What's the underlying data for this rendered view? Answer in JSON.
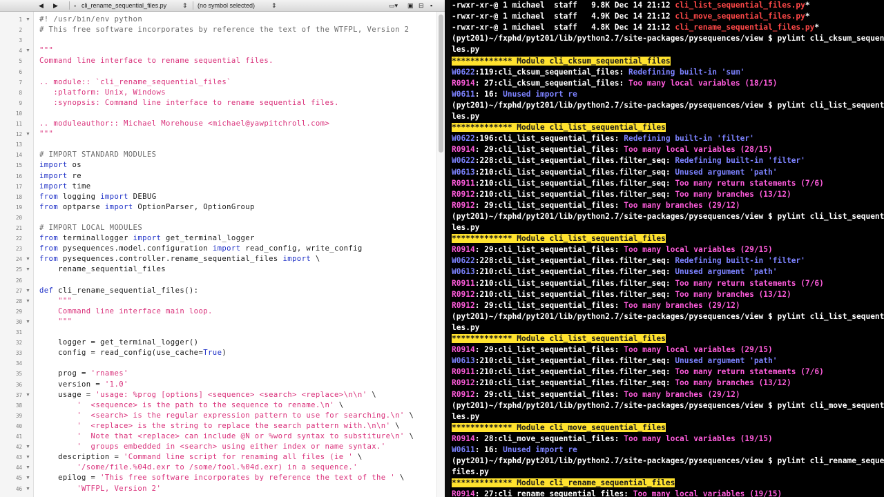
{
  "editor": {
    "toolbar": {
      "back_icon": "back-arrow-icon",
      "forward_icon": "forward-arrow-icon",
      "file_name": "cli_rename_sequential_files.py",
      "symbol": "(no symbol selected)"
    },
    "lines": [
      {
        "n": "1",
        "fold": true,
        "segs": [
          {
            "c": "com",
            "t": "#! /usr/bin/env python"
          }
        ]
      },
      {
        "n": "2",
        "segs": [
          {
            "c": "com",
            "t": "# This free software incorporates by reference the text of the WTFPL, Version 2"
          }
        ]
      },
      {
        "n": "3",
        "segs": []
      },
      {
        "n": "4",
        "fold": true,
        "segs": [
          {
            "c": "str",
            "t": "\"\"\""
          }
        ]
      },
      {
        "n": "5",
        "segs": [
          {
            "c": "str",
            "t": "Command line interface to rename sequential files."
          }
        ]
      },
      {
        "n": "6",
        "segs": []
      },
      {
        "n": "7",
        "segs": [
          {
            "c": "str",
            "t": ".. module:: `cli_rename_sequential_files`"
          }
        ]
      },
      {
        "n": "8",
        "segs": [
          {
            "c": "str",
            "t": "   :platform: Unix, Windows"
          }
        ]
      },
      {
        "n": "9",
        "segs": [
          {
            "c": "str",
            "t": "   :synopsis: Command line interface to rename sequential files."
          }
        ]
      },
      {
        "n": "10",
        "segs": []
      },
      {
        "n": "11",
        "segs": [
          {
            "c": "str",
            "t": ".. moduleauthor:: Michael Morehouse <michael@yawpitchroll.com>"
          }
        ]
      },
      {
        "n": "12",
        "fold": true,
        "segs": [
          {
            "c": "str",
            "t": "\"\"\""
          }
        ]
      },
      {
        "n": "13",
        "segs": []
      },
      {
        "n": "14",
        "segs": [
          {
            "c": "com",
            "t": "# IMPORT STANDARD MODULES"
          }
        ]
      },
      {
        "n": "15",
        "segs": [
          {
            "c": "kw",
            "t": "import"
          },
          {
            "c": "plain",
            "t": " os"
          }
        ]
      },
      {
        "n": "16",
        "segs": [
          {
            "c": "kw",
            "t": "import"
          },
          {
            "c": "plain",
            "t": " re"
          }
        ]
      },
      {
        "n": "17",
        "segs": [
          {
            "c": "kw",
            "t": "import"
          },
          {
            "c": "plain",
            "t": " time"
          }
        ]
      },
      {
        "n": "18",
        "segs": [
          {
            "c": "kw",
            "t": "from"
          },
          {
            "c": "plain",
            "t": " logging "
          },
          {
            "c": "kw",
            "t": "import"
          },
          {
            "c": "plain",
            "t": " DEBUG"
          }
        ]
      },
      {
        "n": "19",
        "segs": [
          {
            "c": "kw",
            "t": "from"
          },
          {
            "c": "plain",
            "t": " optparse "
          },
          {
            "c": "kw",
            "t": "import"
          },
          {
            "c": "plain",
            "t": " OptionParser, OptionGroup"
          }
        ]
      },
      {
        "n": "20",
        "segs": []
      },
      {
        "n": "21",
        "segs": [
          {
            "c": "com",
            "t": "# IMPORT LOCAL MODULES"
          }
        ]
      },
      {
        "n": "22",
        "segs": [
          {
            "c": "kw",
            "t": "from"
          },
          {
            "c": "plain",
            "t": " terminallogger "
          },
          {
            "c": "kw",
            "t": "import"
          },
          {
            "c": "plain",
            "t": " get_terminal_logger"
          }
        ]
      },
      {
        "n": "23",
        "segs": [
          {
            "c": "kw",
            "t": "from"
          },
          {
            "c": "plain",
            "t": " pysequences.model.configuration "
          },
          {
            "c": "kw",
            "t": "import"
          },
          {
            "c": "plain",
            "t": " read_config, write_config"
          }
        ]
      },
      {
        "n": "24",
        "fold": true,
        "segs": [
          {
            "c": "kw",
            "t": "from"
          },
          {
            "c": "plain",
            "t": " pysequences.controller.rename_sequential_files "
          },
          {
            "c": "kw",
            "t": "import"
          },
          {
            "c": "plain",
            "t": " \\"
          }
        ]
      },
      {
        "n": "25",
        "fold": true,
        "segs": [
          {
            "c": "plain",
            "t": "    rename_sequential_files"
          }
        ]
      },
      {
        "n": "26",
        "segs": []
      },
      {
        "n": "27",
        "fold": true,
        "segs": [
          {
            "c": "kw",
            "t": "def"
          },
          {
            "c": "plain",
            "t": " cli_rename_sequential_files():"
          }
        ]
      },
      {
        "n": "28",
        "fold": true,
        "segs": [
          {
            "c": "str",
            "t": "    \"\"\""
          }
        ]
      },
      {
        "n": "29",
        "segs": [
          {
            "c": "str",
            "t": "    Command line interface main loop."
          }
        ]
      },
      {
        "n": "30",
        "fold": true,
        "segs": [
          {
            "c": "str",
            "t": "    \"\"\""
          }
        ]
      },
      {
        "n": "31",
        "segs": []
      },
      {
        "n": "32",
        "segs": [
          {
            "c": "plain",
            "t": "    logger = get_terminal_logger()"
          }
        ]
      },
      {
        "n": "33",
        "segs": [
          {
            "c": "plain",
            "t": "    config = read_config(use_cache="
          },
          {
            "c": "kw",
            "t": "True"
          },
          {
            "c": "plain",
            "t": ")"
          }
        ]
      },
      {
        "n": "34",
        "segs": []
      },
      {
        "n": "35",
        "segs": [
          {
            "c": "plain",
            "t": "    prog = "
          },
          {
            "c": "str",
            "t": "'rnames'"
          }
        ]
      },
      {
        "n": "36",
        "segs": [
          {
            "c": "plain",
            "t": "    version = "
          },
          {
            "c": "str",
            "t": "'1.0'"
          }
        ]
      },
      {
        "n": "37",
        "fold": true,
        "segs": [
          {
            "c": "plain",
            "t": "    usage = "
          },
          {
            "c": "str",
            "t": "'usage: %prog [options] <sequence> <search> <replace>\\n\\n'"
          },
          {
            "c": "plain",
            "t": " \\"
          }
        ]
      },
      {
        "n": "38",
        "segs": [
          {
            "c": "str",
            "t": "        '  <sequence> is the path to the sequence to rename.\\n'"
          },
          {
            "c": "plain",
            "t": " \\"
          }
        ]
      },
      {
        "n": "39",
        "segs": [
          {
            "c": "str",
            "t": "        '  <search> is the regular expression pattern to use for searching.\\n'"
          },
          {
            "c": "plain",
            "t": " \\"
          }
        ]
      },
      {
        "n": "40",
        "segs": [
          {
            "c": "str",
            "t": "        '  <replace> is the string to replace the search pattern with.\\n\\n'"
          },
          {
            "c": "plain",
            "t": " \\"
          }
        ]
      },
      {
        "n": "41",
        "segs": [
          {
            "c": "str",
            "t": "        '  Note that <replace> can include @N or %word syntax to substiture\\n'"
          },
          {
            "c": "plain",
            "t": " \\"
          }
        ]
      },
      {
        "n": "42",
        "fold": true,
        "segs": [
          {
            "c": "str",
            "t": "        '  groups embedded in <search> using either index or name syntax.'"
          }
        ]
      },
      {
        "n": "43",
        "fold": true,
        "segs": [
          {
            "c": "plain",
            "t": "    description = "
          },
          {
            "c": "str",
            "t": "'Command line script for renaming all files (ie '"
          },
          {
            "c": "plain",
            "t": " \\"
          }
        ]
      },
      {
        "n": "44",
        "fold": true,
        "segs": [
          {
            "c": "str",
            "t": "        '/some/file.%04d.exr to /some/fool.%04d.exr) in a sequence.'"
          }
        ]
      },
      {
        "n": "45",
        "fold": true,
        "segs": [
          {
            "c": "plain",
            "t": "    epilog = "
          },
          {
            "c": "str",
            "t": "'This free software incorporates by reference the text of the '"
          },
          {
            "c": "plain",
            "t": " \\"
          }
        ]
      },
      {
        "n": "46",
        "fold": true,
        "segs": [
          {
            "c": "str",
            "t": "        'WTFPL, Version 2'"
          }
        ]
      }
    ]
  },
  "terminal": {
    "lines": [
      [
        {
          "c": "w",
          "t": "-rwxr-xr-@ 1 michael  staff   9.8K Dec 14 21:12 "
        },
        {
          "c": "red",
          "t": "cli_list_sequential_files.py"
        },
        {
          "c": "w",
          "t": "*"
        }
      ],
      [
        {
          "c": "w",
          "t": "-rwxr-xr-@ 1 michael  staff   4.9K Dec 14 21:12 "
        },
        {
          "c": "red",
          "t": "cli_move_sequential_files.py"
        },
        {
          "c": "w",
          "t": "*"
        }
      ],
      [
        {
          "c": "w",
          "t": "-rwxr-xr-@ 1 michael  staff   4.8K Dec 14 21:12 "
        },
        {
          "c": "red",
          "t": "cli_rename_sequential_files.py"
        },
        {
          "c": "w",
          "t": "*"
        }
      ],
      [
        {
          "c": "w",
          "t": "(pyt201)~/fxphd/pyt201/lib/python2.7/site-packages/pysequences/view $ pylint cli_cksum_sequential_fi"
        }
      ],
      [
        {
          "c": "w",
          "t": "les.py"
        }
      ],
      [
        {
          "c": "ban",
          "t": "************* Module cli_cksum_sequential_files"
        }
      ],
      [
        {
          "c": "blue",
          "t": "W0622"
        },
        {
          "c": "w",
          "t": ":119:cli_cksum_sequential_files: "
        },
        {
          "c": "blue",
          "t": "Redefining built-in 'sum'"
        }
      ],
      [
        {
          "c": "mag",
          "t": "R0914"
        },
        {
          "c": "w",
          "t": ": 27:cli_cksum_sequential_files: "
        },
        {
          "c": "mag",
          "t": "Too many local variables (18/15)"
        }
      ],
      [
        {
          "c": "blue",
          "t": "W0611"
        },
        {
          "c": "w",
          "t": ": 16: "
        },
        {
          "c": "blue",
          "t": "Unused import re"
        }
      ],
      [
        {
          "c": "w",
          "t": "(pyt201)~/fxphd/pyt201/lib/python2.7/site-packages/pysequences/view $ pylint cli_list_sequential_fi"
        }
      ],
      [
        {
          "c": "w",
          "t": "les.py"
        }
      ],
      [
        {
          "c": "ban",
          "t": "************* Module cli_list_sequential_files"
        }
      ],
      [
        {
          "c": "blue",
          "t": "W0622"
        },
        {
          "c": "w",
          "t": ":196:cli_list_sequential_files: "
        },
        {
          "c": "blue",
          "t": "Redefining built-in 'filter'"
        }
      ],
      [
        {
          "c": "mag",
          "t": "R0914"
        },
        {
          "c": "w",
          "t": ": 29:cli_list_sequential_files: "
        },
        {
          "c": "mag",
          "t": "Too many local variables (28/15)"
        }
      ],
      [
        {
          "c": "blue",
          "t": "W0622"
        },
        {
          "c": "w",
          "t": ":228:cli_list_sequential_files.filter_seq: "
        },
        {
          "c": "blue",
          "t": "Redefining built-in 'filter'"
        }
      ],
      [
        {
          "c": "blue",
          "t": "W0613"
        },
        {
          "c": "w",
          "t": ":210:cli_list_sequential_files.filter_seq: "
        },
        {
          "c": "blue",
          "t": "Unused argument 'path'"
        }
      ],
      [
        {
          "c": "mag",
          "t": "R0911"
        },
        {
          "c": "w",
          "t": ":210:cli_list_sequential_files.filter_seq: "
        },
        {
          "c": "mag",
          "t": "Too many return statements (7/6)"
        }
      ],
      [
        {
          "c": "mag",
          "t": "R0912"
        },
        {
          "c": "w",
          "t": ":210:cli_list_sequential_files.filter_seq: "
        },
        {
          "c": "mag",
          "t": "Too many branches (13/12)"
        }
      ],
      [
        {
          "c": "mag",
          "t": "R0912"
        },
        {
          "c": "w",
          "t": ": 29:cli_list_sequential_files: "
        },
        {
          "c": "mag",
          "t": "Too many branches (29/12)"
        }
      ],
      [
        {
          "c": "w",
          "t": "(pyt201)~/fxphd/pyt201/lib/python2.7/site-packages/pysequences/view $ pylint cli_list_sequential_fi"
        }
      ],
      [
        {
          "c": "w",
          "t": "les.py"
        }
      ],
      [
        {
          "c": "ban",
          "t": "************* Module cli_list_sequential_files"
        }
      ],
      [
        {
          "c": "mag",
          "t": "R0914"
        },
        {
          "c": "w",
          "t": ": 29:cli_list_sequential_files: "
        },
        {
          "c": "mag",
          "t": "Too many local variables (29/15)"
        }
      ],
      [
        {
          "c": "blue",
          "t": "W0622"
        },
        {
          "c": "w",
          "t": ":228:cli_list_sequential_files.filter_seq: "
        },
        {
          "c": "blue",
          "t": "Redefining built-in 'filter'"
        }
      ],
      [
        {
          "c": "blue",
          "t": "W0613"
        },
        {
          "c": "w",
          "t": ":210:cli_list_sequential_files.filter_seq: "
        },
        {
          "c": "blue",
          "t": "Unused argument 'path'"
        }
      ],
      [
        {
          "c": "mag",
          "t": "R0911"
        },
        {
          "c": "w",
          "t": ":210:cli_list_sequential_files.filter_seq: "
        },
        {
          "c": "mag",
          "t": "Too many return statements (7/6)"
        }
      ],
      [
        {
          "c": "mag",
          "t": "R0912"
        },
        {
          "c": "w",
          "t": ":210:cli_list_sequential_files.filter_seq: "
        },
        {
          "c": "mag",
          "t": "Too many branches (13/12)"
        }
      ],
      [
        {
          "c": "mag",
          "t": "R0912"
        },
        {
          "c": "w",
          "t": ": 29:cli_list_sequential_files: "
        },
        {
          "c": "mag",
          "t": "Too many branches (29/12)"
        }
      ],
      [
        {
          "c": "w",
          "t": "(pyt201)~/fxphd/pyt201/lib/python2.7/site-packages/pysequences/view $ pylint cli_list_sequential_fi"
        }
      ],
      [
        {
          "c": "w",
          "t": "les.py"
        }
      ],
      [
        {
          "c": "ban",
          "t": "************* Module cli_list_sequential_files"
        }
      ],
      [
        {
          "c": "mag",
          "t": "R0914"
        },
        {
          "c": "w",
          "t": ": 29:cli_list_sequential_files: "
        },
        {
          "c": "mag",
          "t": "Too many local variables (29/15)"
        }
      ],
      [
        {
          "c": "blue",
          "t": "W0613"
        },
        {
          "c": "w",
          "t": ":210:cli_list_sequential_files.filter_seq: "
        },
        {
          "c": "blue",
          "t": "Unused argument 'path'"
        }
      ],
      [
        {
          "c": "mag",
          "t": "R0911"
        },
        {
          "c": "w",
          "t": ":210:cli_list_sequential_files.filter_seq: "
        },
        {
          "c": "mag",
          "t": "Too many return statements (7/6)"
        }
      ],
      [
        {
          "c": "mag",
          "t": "R0912"
        },
        {
          "c": "w",
          "t": ":210:cli_list_sequential_files.filter_seq: "
        },
        {
          "c": "mag",
          "t": "Too many branches (13/12)"
        }
      ],
      [
        {
          "c": "mag",
          "t": "R0912"
        },
        {
          "c": "w",
          "t": ": 29:cli_list_sequential_files: "
        },
        {
          "c": "mag",
          "t": "Too many branches (29/12)"
        }
      ],
      [
        {
          "c": "w",
          "t": "(pyt201)~/fxphd/pyt201/lib/python2.7/site-packages/pysequences/view $ pylint cli_move_sequential_fi"
        }
      ],
      [
        {
          "c": "w",
          "t": "les.py"
        }
      ],
      [
        {
          "c": "ban",
          "t": "************* Module cli_move_sequential_files"
        }
      ],
      [
        {
          "c": "mag",
          "t": "R0914"
        },
        {
          "c": "w",
          "t": ": 28:cli_move_sequential_files: "
        },
        {
          "c": "mag",
          "t": "Too many local variables (19/15)"
        }
      ],
      [
        {
          "c": "blue",
          "t": "W0611"
        },
        {
          "c": "w",
          "t": ": 16: "
        },
        {
          "c": "blue",
          "t": "Unused import re"
        }
      ],
      [
        {
          "c": "w",
          "t": "(pyt201)~/fxphd/pyt201/lib/python2.7/site-packages/pysequences/view $ pylint cli_rename_sequential_"
        }
      ],
      [
        {
          "c": "w",
          "t": "files.py"
        }
      ],
      [
        {
          "c": "ban",
          "t": "************* Module cli_rename_sequential_files"
        }
      ],
      [
        {
          "c": "mag",
          "t": "R0914"
        },
        {
          "c": "w",
          "t": ": 27:cli_rename_sequential_files: "
        },
        {
          "c": "mag",
          "t": "Too many local variables (19/15)"
        }
      ]
    ]
  },
  "colors": {
    "comment": "#6a6a6a",
    "string": "#d9307a",
    "keyword": "#1f31c7",
    "term_file": "#ff4848",
    "term_warning": "#7c82ff",
    "term_refactor": "#ff5cdc",
    "term_banner": "#ffe22e"
  }
}
